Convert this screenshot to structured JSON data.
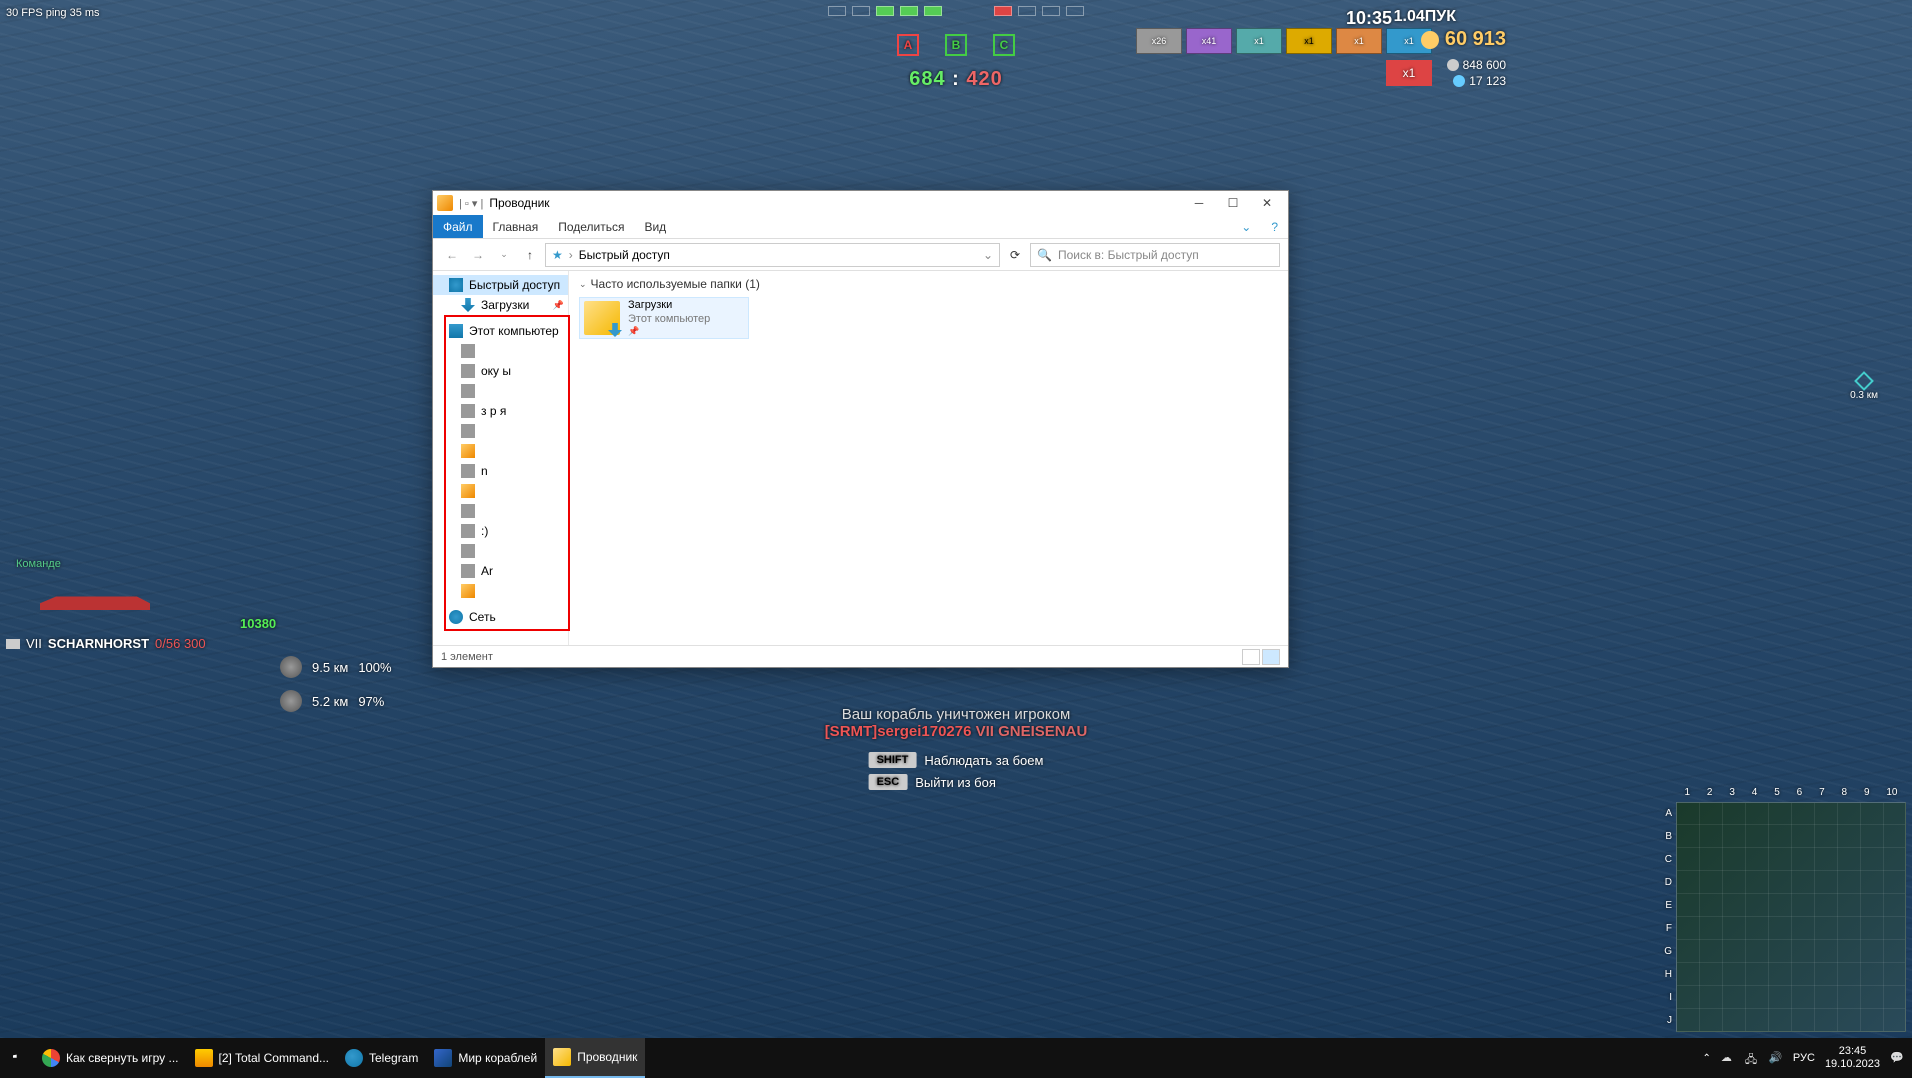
{
  "hud": {
    "fps": "30 FPS  ping 35 ms",
    "squares": [
      "A",
      "B",
      "C"
    ],
    "score_green": "684",
    "score_sep": ":",
    "score_red": "420",
    "clock": "10:35",
    "ship_tr": "1.04ПУК",
    "consumables": [
      {
        "cls": "gray",
        "txt": "x26"
      },
      {
        "cls": "purple",
        "txt": "x41"
      },
      {
        "cls": "teal",
        "txt": "x1"
      },
      {
        "cls": "yellow",
        "txt": "x1"
      },
      {
        "cls": "orange",
        "txt": "x1"
      },
      {
        "cls": "blue",
        "txt": "x1"
      }
    ],
    "flag": "x1",
    "damage": "60 913",
    "credits_line1": "848 600",
    "credits_line2": "17 123",
    "team_label": "Команде",
    "own_ship_tier": "VII",
    "own_ship_name": "SCHARNHORST",
    "own_ship_hp": "0/56 300",
    "green_num": "10380",
    "dist1_km": "9.5 км",
    "dist1_pct": "100%",
    "dist2_km": "5.2 км",
    "dist2_pct": "97%",
    "marker_dist": "0.3 км",
    "kill_l1": "Ваш корабль уничтожен игроком",
    "kill_clan": "[SRMT]",
    "kill_player": "sergei170276",
    "kill_ship_tier": "VII",
    "kill_ship": "GNEISENAU",
    "key1": "SHIFT",
    "key1_txt": "Наблюдать за боем",
    "key2": "ESC",
    "key2_txt": "Выйти из боя",
    "mm_cols": [
      "1",
      "2",
      "3",
      "4",
      "5",
      "6",
      "7",
      "8",
      "9",
      "10"
    ],
    "mm_rows": [
      "A",
      "B",
      "C",
      "D",
      "E",
      "F",
      "G",
      "H",
      "I",
      "J"
    ]
  },
  "explorer": {
    "title": "Проводник",
    "ribbon": {
      "file": "Файл",
      "tabs": [
        "Главная",
        "Поделиться",
        "Вид"
      ]
    },
    "addr_text": "Быстрый доступ",
    "search_placeholder": "Поиск в: Быстрый доступ",
    "side": {
      "quick": "Быстрый доступ",
      "downloads": "Загрузки",
      "pc": "Этот компьютер",
      "net": "Сеть",
      "partial": [
        "",
        "оку    ы",
        "",
        "з р      я",
        "",
        "",
        "n",
        "",
        "",
        ":)",
        "",
        "Ar",
        ""
      ]
    },
    "group_header": "Часто используемые папки (1)",
    "tile": {
      "name": "Загрузки",
      "sub": "Этот компьютер"
    },
    "status": "1 элемент"
  },
  "taskbar": {
    "items": [
      {
        "ico": "chrome",
        "label": "Как свернуть игру ..."
      },
      {
        "ico": "tc",
        "label": "[2] Total Command..."
      },
      {
        "ico": "tg",
        "label": "Telegram"
      },
      {
        "ico": "wows",
        "label": "Мир кораблей"
      },
      {
        "ico": "folder",
        "label": "Проводник",
        "active": true
      }
    ],
    "tray": {
      "lang": "РУС",
      "time": "23:45",
      "date": "19.10.2023"
    }
  }
}
